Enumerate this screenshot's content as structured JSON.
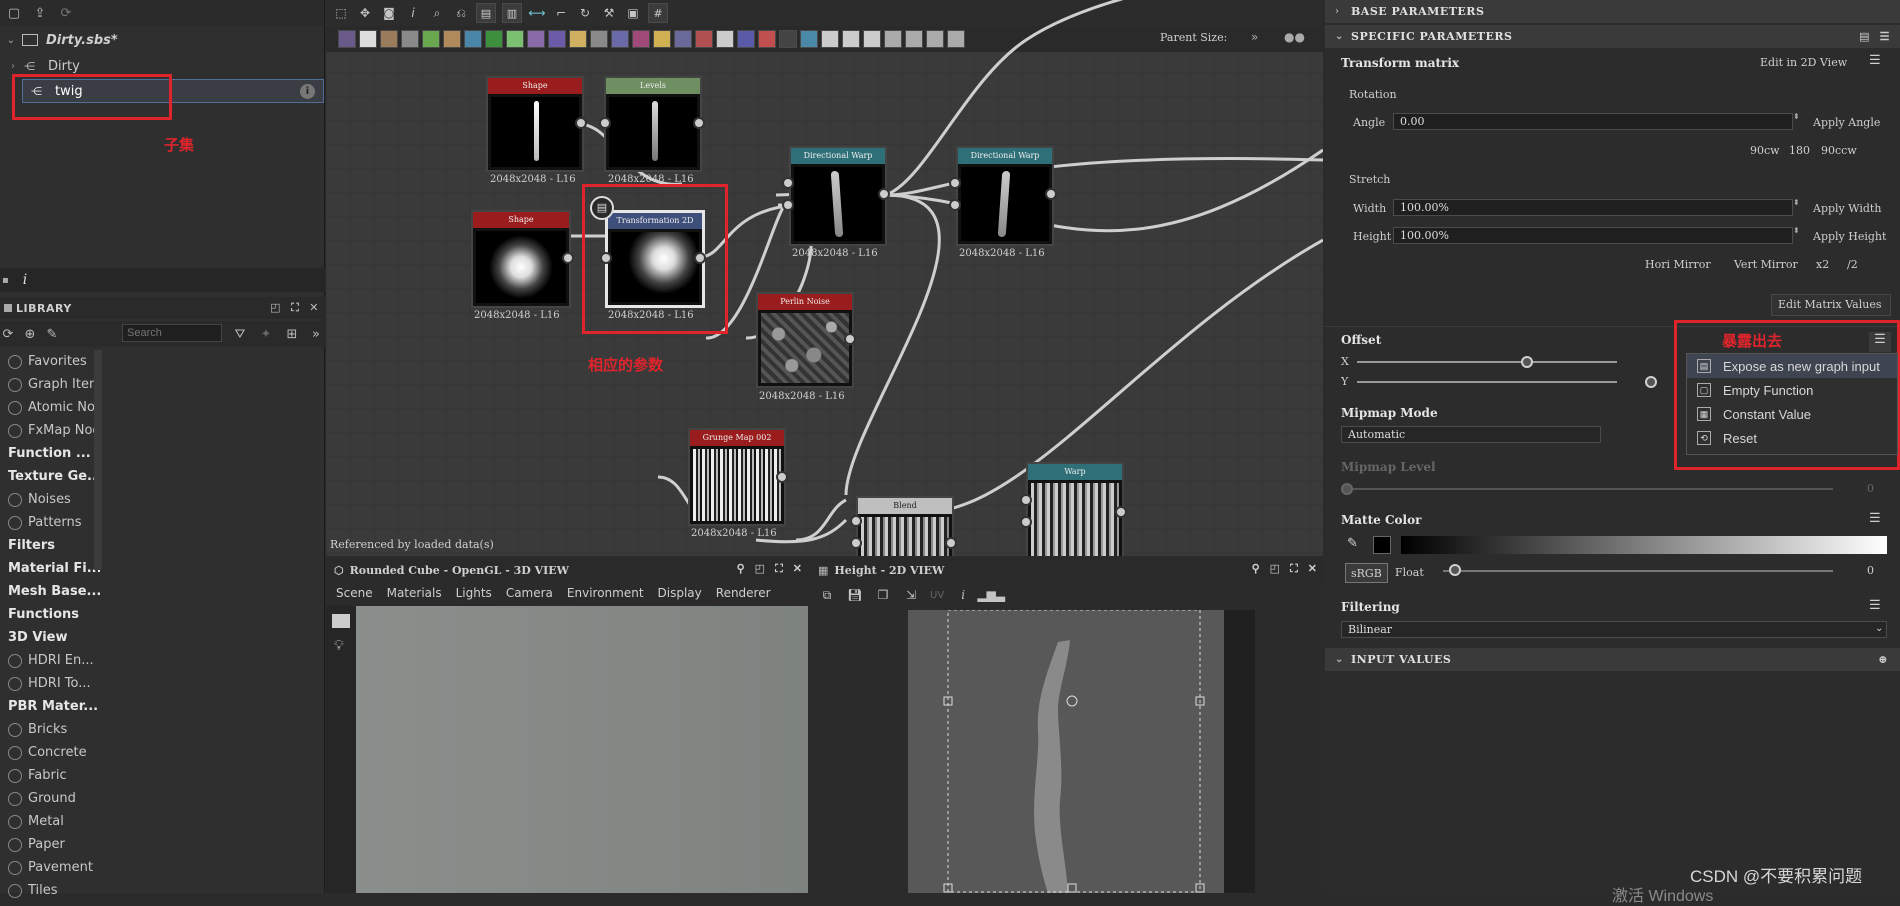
{
  "explorer": {
    "package_name": "Dirty.sbs*",
    "graph_name": "Dirty",
    "selected_item": "twig",
    "annotation": "子集"
  },
  "library": {
    "title": "LIBRARY",
    "search_placeholder": "Search",
    "items": [
      {
        "label": "Favorites",
        "bold": false
      },
      {
        "label": "Graph Items",
        "bold": false
      },
      {
        "label": "Atomic No...",
        "bold": false
      },
      {
        "label": "FxMap Nod...",
        "bold": false
      },
      {
        "label": "Function ...",
        "bold": true
      },
      {
        "label": "Texture Ge...",
        "bold": true
      },
      {
        "label": "Noises",
        "bold": false
      },
      {
        "label": "Patterns",
        "bold": false
      },
      {
        "label": "Filters",
        "bold": true
      },
      {
        "label": "Material Fi...",
        "bold": true
      },
      {
        "label": "Mesh Base...",
        "bold": true
      },
      {
        "label": "Functions",
        "bold": true
      },
      {
        "label": "3D View",
        "bold": true
      },
      {
        "label": "HDRI En...",
        "bold": false
      },
      {
        "label": "HDRI To...",
        "bold": false
      },
      {
        "label": "PBR Mater...",
        "bold": true
      },
      {
        "label": "Bricks",
        "bold": false
      },
      {
        "label": "Concrete",
        "bold": false
      },
      {
        "label": "Fabric",
        "bold": false
      },
      {
        "label": "Ground",
        "bold": false
      },
      {
        "label": "Metal",
        "bold": false
      },
      {
        "label": "Paper",
        "bold": false
      },
      {
        "label": "Pavement",
        "bold": false
      },
      {
        "label": "Tiles",
        "bold": false
      }
    ]
  },
  "graph": {
    "parent_size_label": "Parent Size:",
    "status": "Referenced by loaded data(s)",
    "annotation": "相应的参数",
    "nodes": {
      "shape1": {
        "title": "Shape",
        "label": "2048x2048 - L16"
      },
      "levels": {
        "title": "Levels",
        "label": "2048x2048 - L16"
      },
      "shape2": {
        "title": "Shape",
        "label": "2048x2048 - L16"
      },
      "transform": {
        "title": "Transformation 2D",
        "label": "2048x2048 - L16"
      },
      "dirwarp1": {
        "title": "Directional Warp",
        "label": "2048x2048 - L16"
      },
      "dirwarp2": {
        "title": "Directional Warp",
        "label": "2048x2048 - L16"
      },
      "perlin": {
        "title": "Perlin Noise",
        "label": "2048x2048 - L16"
      },
      "grunge": {
        "title": "Grunge Map 002",
        "label": "2048x2048 - L16"
      },
      "blend": {
        "title": "Blend",
        "label": ""
      },
      "warp": {
        "title": "Warp",
        "label": ""
      }
    }
  },
  "view3d": {
    "title": "Rounded Cube - OpenGL - 3D VIEW",
    "menu": [
      "Scene",
      "Materials",
      "Lights",
      "Camera",
      "Environment",
      "Display",
      "Renderer"
    ]
  },
  "view2d": {
    "title": "Height - 2D VIEW",
    "uv_label": "UV"
  },
  "params": {
    "base_parameters": "BASE PARAMETERS",
    "specific_parameters": "SPECIFIC PARAMETERS",
    "transform_matrix": "Transform matrix",
    "edit_2d_view": "Edit in 2D View",
    "rotation": "Rotation",
    "angle_label": "Angle",
    "angle_value": "0.00",
    "apply_angle": "Apply Angle",
    "rot_90cw": "90cw",
    "rot_180": "180",
    "rot_90ccw": "90ccw",
    "stretch": "Stretch",
    "width_label": "Width",
    "width_value": "100.00%",
    "apply_width": "Apply Width",
    "height_label": "Height",
    "height_value": "100.00%",
    "apply_height": "Apply Height",
    "hori_mirror": "Hori Mirror",
    "vert_mirror": "Vert Mirror",
    "x2": "x2",
    "div2": "/2",
    "edit_matrix": "Edit Matrix Values",
    "offset": "Offset",
    "offset_x_label": "X",
    "offset_y_label": "Y",
    "offset_annotation": "暴露出去",
    "mipmap_mode": "Mipmap Mode",
    "mipmap_mode_value": "Automatic",
    "mipmap_level": "Mipmap Level",
    "mipmap_level_value": "0",
    "matte_color": "Matte Color",
    "srgb": "sRGB",
    "float": "Float",
    "matte_value": "0",
    "filtering": "Filtering",
    "filtering_value": "Bilinear",
    "input_values": "INPUT VALUES"
  },
  "context_menu": {
    "items": [
      {
        "label": "Expose as new graph input",
        "highlighted": true
      },
      {
        "label": "Empty Function",
        "highlighted": false
      },
      {
        "label": "Constant Value",
        "highlighted": false
      },
      {
        "label": "Reset",
        "highlighted": false
      }
    ]
  },
  "watermark": "CSDN @不要积累问题",
  "watermark_bottom": "激活 Windows"
}
